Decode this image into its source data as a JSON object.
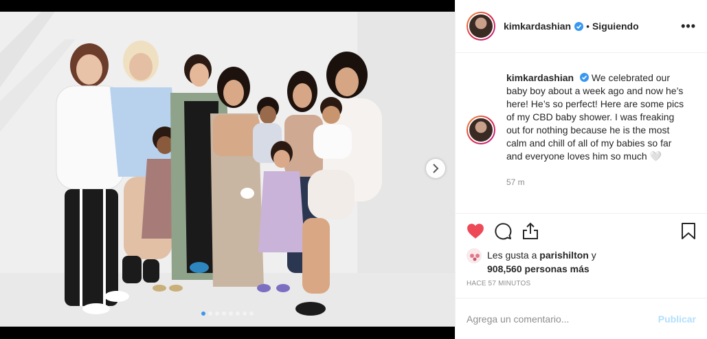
{
  "post": {
    "username": "kimkardashian",
    "follow_separator": "•",
    "follow_status": "Siguiendo",
    "more_label": "•••",
    "caption_text": "We celebrated our baby boy about a week ago and now he’s here! He’s so perfect! Here are some pics of my CBD baby shower. I was freaking out for nothing because he is the most calm and chill of all of my babies so far and everyone loves him so much 🤍",
    "caption_time": "57 m",
    "likes_prefix": "Les gusta a",
    "likes_user": "parishilton",
    "likes_connector": "y",
    "likes_others": "908,560 personas más",
    "posted_ago": "Hace 57 minutos",
    "comment_placeholder": "Agrega un comentario...",
    "publish_label": "Publicar",
    "carousel_count": 8,
    "carousel_active": 0
  },
  "colors": {
    "heart": "#ed4956",
    "verified": "#3897f0",
    "publish_disabled": "#b2dffc",
    "dot_active": "#3897f0"
  },
  "icons": [
    "verified-badge-icon",
    "more-options-icon",
    "heart-icon",
    "comment-icon",
    "share-icon",
    "bookmark-icon",
    "chevron-right-icon"
  ]
}
